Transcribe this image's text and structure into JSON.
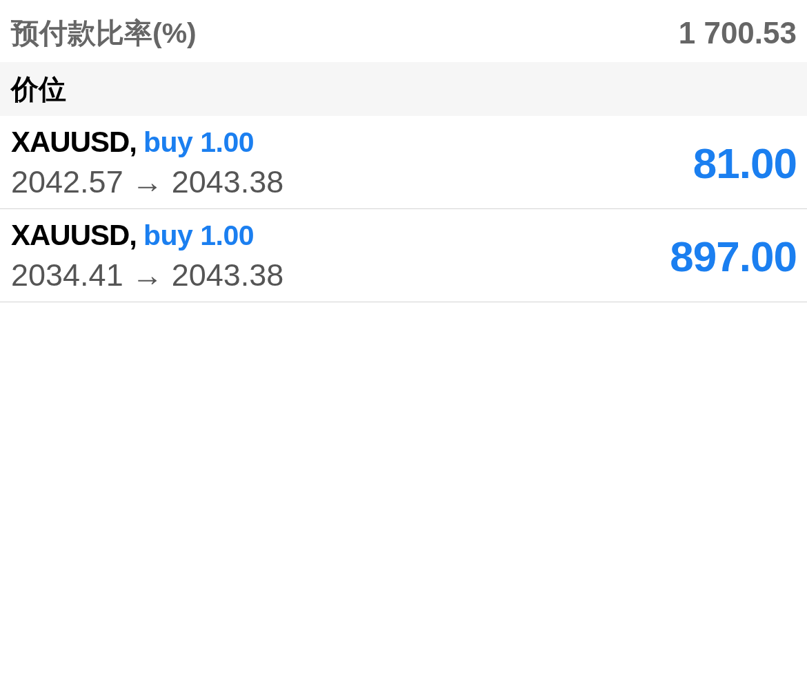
{
  "account_rows": [
    {
      "label": "预付款比率(%)",
      "value": "1 700.53"
    }
  ],
  "sections": [
    {
      "title": "价位",
      "positions": [
        {
          "symbol": "XAUUSD,",
          "order": "buy 1.00",
          "prices": "2042.57 → 2043.38",
          "profit": "81.00"
        },
        {
          "symbol": "XAUUSD,",
          "order": "buy 1.00",
          "prices": "2034.41 → 2043.38",
          "profit": "897.00"
        }
      ]
    }
  ]
}
